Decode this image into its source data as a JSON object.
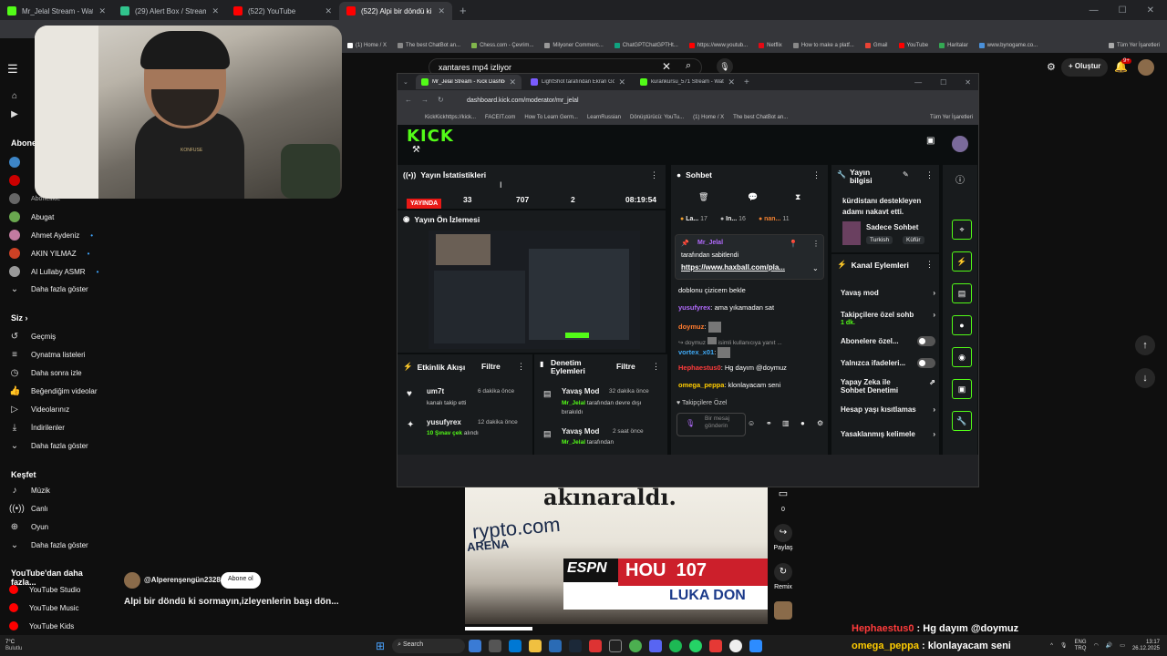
{
  "browser": {
    "tabs": [
      {
        "label": "Mr_Jelal Stream - Watch Live o",
        "color": "#53fc18"
      },
      {
        "label": "(29) Alert Box / Streamlabs",
        "color": "#31c48d"
      },
      {
        "label": "(522) YouTube",
        "color": "#ff0000"
      },
      {
        "label": "(522) Alpi bir döndü ki sormay",
        "color": "#ff0000"
      }
    ],
    "bookmarks": [
      "(1) Home / X",
      "The best ChatBot an...",
      "Chess.com - Çevrim...",
      "Milyoner Commerc...",
      "ChatGPTChatGPTHt...",
      "https://www.youtub...",
      "Netflix",
      "How to make a platf...",
      "Gmail",
      "YouTube",
      "Haritalar",
      "www.bynogame.co...",
      "Tüm Yer İşaretleri"
    ]
  },
  "youtube": {
    "search_value": "xantares mp4 izliyor",
    "create_label": "Oluştur",
    "notif_count": "9+",
    "sidebar": {
      "subs_title": "Abonel",
      "channels": [
        {
          "name": "Abugat",
          "color": "#6aa84f"
        },
        {
          "name": "Ahmet Aydeniz",
          "color": "#c27ba0"
        },
        {
          "name": "AKIN YILMAZ",
          "color": "#cc4125"
        },
        {
          "name": "Al Lullaby ASMR",
          "color": "#999999"
        }
      ],
      "partial_channel": "Abonelikle",
      "show_more": "Daha fazla göster",
      "you_title": "Siz",
      "you_items": [
        "Geçmiş",
        "Oynatma listeleri",
        "Daha sonra izle",
        "Beğendiğim videolar",
        "Videolarınız",
        "İndirilenler",
        "Daha fazla göster"
      ],
      "explore_title": "Keşfet",
      "explore_items": [
        "Müzik",
        "Canlı",
        "Oyun",
        "Daha fazla göster"
      ],
      "more_title": "YouTube'dan daha fazla...",
      "more_items": [
        "YouTube Studio",
        "YouTube Music",
        "YouTube Kids"
      ]
    },
    "channel_handle": "@Alperenşengün2328",
    "subscribe_label": "Abone ol",
    "video_title": "Alpi bir döndü ki sormayın,izleyenlerin başı dön...",
    "video_text_top": "akınaraldı.",
    "video_brand": "rypto.com",
    "video_arena": "ARENA",
    "score_network": "ESPN",
    "score_team": "HOU",
    "score_points": "107",
    "score_name": "LUKA DON",
    "side_actions": {
      "comments": "0",
      "share": "Paylaş",
      "remix": "Remix"
    }
  },
  "webcam": {
    "shirt_text": "KONFUSE"
  },
  "kick": {
    "tabs": [
      "Mr_Jelal Stream - Kick Dashbo",
      "LightShot tarafından Ekran Gö",
      "kurankursu_571 Stream - Watc"
    ],
    "url": "dashboard.kick.com/moderator/mr_jelal",
    "bookmarks": [
      "KickKickhttps://kick...",
      "FACEIT.com",
      "How To Learn Germ...",
      "LearnRussian",
      "Dönüştürücü: YouTu...",
      "(1) Home / X",
      "The best ChatBot an...",
      "Tüm Yer İşaretleri"
    ],
    "logo": "KICK",
    "stats": {
      "title": "Yayın İstatistikleri",
      "live": "YAYINDA",
      "viewers": "33",
      "followers": "707",
      "subs": "2",
      "uptime": "08:19:54"
    },
    "preview_title": "Yayın Ön İzlemesi",
    "activity": {
      "title": "Etkinlik Akışı",
      "filter": "Filtre",
      "items": [
        {
          "user": "um7t",
          "time": "6 dakika önce",
          "desc": "kanalı takip etti",
          "highlight": ""
        },
        {
          "user": "yusufyrex",
          "time": "12 dakika önce",
          "desc": "alındı",
          "highlight": "10 Şınav çek"
        }
      ]
    },
    "moderation": {
      "title": "Denetim Eylemleri",
      "filter": "Filtre",
      "items": [
        {
          "action": "Yavaş Mod",
          "time": "32 dakika önce",
          "user": "Mr_Jelal",
          "desc": "tarafından devre dışı bırakıldı"
        },
        {
          "action": "Yavaş Mod",
          "time": "2 saat önce",
          "user": "Mr_Jelal",
          "desc": "tarafından"
        }
      ]
    },
    "chat": {
      "title": "Sohbet",
      "top_users": [
        {
          "name": "La...",
          "n": "17"
        },
        {
          "name": "In...",
          "n": "16"
        },
        {
          "name": "nan...",
          "n": "11"
        }
      ],
      "pinned_user": "Mr_Jelal",
      "pinned_by": "tarafından sabitlendi",
      "pinned_link": "https://www.haxball.com/pla...",
      "messages": [
        {
          "user": "",
          "text": "doblonu çizicem bekle",
          "color": "#fff"
        },
        {
          "user": "yusufyrex",
          "text": "ama yıkamadan sat",
          "color": "#b36bff"
        },
        {
          "user": "doymuz",
          "text": "",
          "color": "#ff7b2e"
        },
        {
          "user": "doymuz",
          "text": "isimli kullanıcıya yanıt ...",
          "color": "#999"
        },
        {
          "user": "vortex_x01",
          "text": "",
          "color": "#3fa9f5"
        },
        {
          "user": "Hephaestus0",
          "text": "Hg dayım @doymuz",
          "color": "#ff3b3b"
        },
        {
          "user": "omega_peppa",
          "text": "klonlayacam seni",
          "color": "#ffcc00"
        }
      ],
      "followers_only": "Takipçilere Özel",
      "send_placeholder": "Bir mesaj gönderin"
    },
    "stream_info": {
      "title": "Yayın bilgisi",
      "stream_title": "kürdistanı destekleyen adamı nakavt etti.",
      "category": "Sadece Sohbet",
      "tags": [
        "Turkish",
        "Küfür"
      ]
    },
    "channel_actions": {
      "title": "Kanal Eylemleri",
      "items": [
        {
          "label": "Yavaş mod",
          "type": "arrow",
          "sub": ""
        },
        {
          "label": "Takipçilere özel sohb",
          "type": "arrow",
          "sub": "1 dk."
        },
        {
          "label": "Abonelere özel...",
          "type": "toggle",
          "sub": ""
        },
        {
          "label": "Yalnızca ifadeleri...",
          "type": "toggle",
          "sub": ""
        },
        {
          "label": "Yapay Zeka ile Sohbet Denetimi",
          "type": "icon",
          "sub": ""
        },
        {
          "label": "Hesap yaşı kısıtlamas",
          "type": "arrow",
          "sub": ""
        },
        {
          "label": "Yasaklanmış kelimele",
          "type": "arrow",
          "sub": ""
        }
      ]
    }
  },
  "overlay_chat": [
    {
      "user": "Hephaestus0",
      "text": "Hg dayım @doymuz",
      "color": "#ff3b3b"
    },
    {
      "user": "omega_peppa",
      "text": "klonlayacam seni",
      "color": "#ffcc00"
    }
  ],
  "taskbar": {
    "search": "Search",
    "weather_temp": "7°C",
    "weather_desc": "Bulutlu",
    "lang1": "ENG",
    "lang2": "TRQ",
    "time": "13:17",
    "date": "26.12.2025"
  }
}
